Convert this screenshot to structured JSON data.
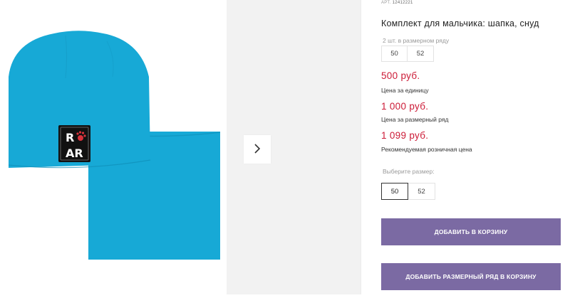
{
  "colors": {
    "accent": "#7b6aa3",
    "price": "#cc1a36",
    "product": "#17a9d6"
  },
  "product_image": {
    "badge_line1_left": "R",
    "badge_line2": "AR"
  },
  "gallery": {
    "next_icon": "chevron-right-icon"
  },
  "product": {
    "sku_label": "АРТ.",
    "sku": "12412221",
    "title": "Комплект для мальчика: шапка, снуд",
    "pack_label": "2 шт. в размерном ряду",
    "pack_sizes": [
      "50",
      "52"
    ]
  },
  "prices": {
    "unit_price": "500 руб.",
    "unit_note": "Цена за единицу",
    "row_price": "1 000 руб.",
    "row_note": "Цена за размерный ряд",
    "retail_price": "1 099 руб.",
    "retail_note": "Рекомендуемая розничная цена"
  },
  "size_select": {
    "label": "Выберите размер:",
    "options": [
      "50",
      "52"
    ],
    "selected": "50"
  },
  "buttons": {
    "add_to_cart": "ДОБАВИТЬ В КОРЗИНУ",
    "add_row_to_cart": "ДОБАВИТЬ РАЗМЕРНЫЙ РЯД В КОРЗИНУ"
  }
}
